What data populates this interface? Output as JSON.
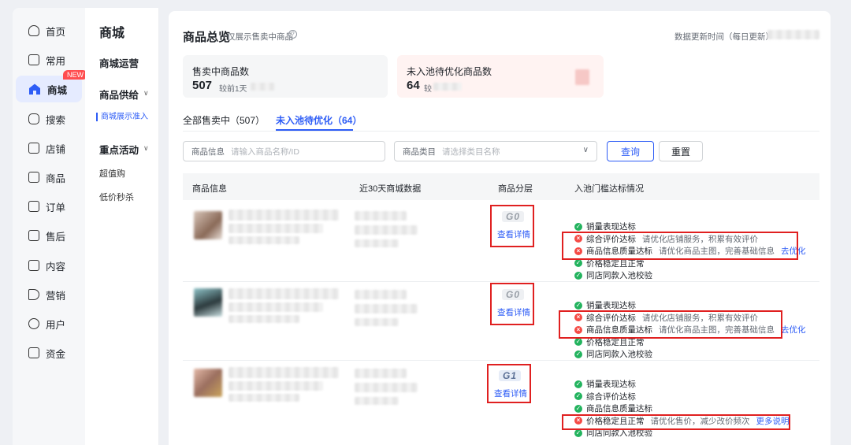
{
  "nav": {
    "items": [
      {
        "label": "首页",
        "icon": "home-outline-icon"
      },
      {
        "label": "常用",
        "icon": "folder-icon"
      },
      {
        "label": "商城",
        "icon": "store-icon",
        "badge": "NEW",
        "active": true
      },
      {
        "label": "搜索",
        "icon": "search-icon"
      },
      {
        "label": "店铺",
        "icon": "shop-icon"
      },
      {
        "label": "商品",
        "icon": "product-icon"
      },
      {
        "label": "订单",
        "icon": "order-icon"
      },
      {
        "label": "售后",
        "icon": "after-sale-icon"
      },
      {
        "label": "内容",
        "icon": "content-icon"
      },
      {
        "label": "营销",
        "icon": "megaphone-icon"
      },
      {
        "label": "用户",
        "icon": "user-icon"
      },
      {
        "label": "资金",
        "icon": "wallet-icon"
      }
    ]
  },
  "subnav": {
    "title": "商城",
    "groups": [
      {
        "label": "商城运营"
      },
      {
        "label": "商品供给",
        "items": [
          "商城展示准入"
        ]
      },
      {
        "label": "重点活动",
        "items": [
          "超值购",
          "低价秒杀"
        ]
      }
    ]
  },
  "header": {
    "title": "商品总览",
    "subtitle": "仅展示售卖中商品",
    "update_label": "数据更新时间（每日更新）"
  },
  "cards": [
    {
      "label": "售卖中商品数",
      "value": "507",
      "compare": "较前1天"
    },
    {
      "label": "未入池待优化商品数",
      "value": "64",
      "compare": "较"
    }
  ],
  "tabs": [
    {
      "label": "全部售卖中（507）"
    },
    {
      "label": "未入池待优化（64）",
      "active": true
    }
  ],
  "filters": {
    "product_label": "商品信息",
    "product_placeholder": "请输入商品名称/ID",
    "category_label": "商品类目",
    "category_placeholder": "请选择类目名称",
    "search_button": "查询",
    "reset_button": "重置"
  },
  "table": {
    "columns": [
      "商品信息",
      "近30天商城数据",
      "商品分层",
      "入池门槛达标情况"
    ],
    "rows": [
      {
        "tier": "G0",
        "detail_link": "查看详情",
        "checks": [
          {
            "status": "ok",
            "text": "销量表现达标"
          },
          {
            "status": "bad",
            "text": "综合评价达标",
            "hint": "请优化店铺服务，积累有效评价"
          },
          {
            "status": "bad",
            "text": "商品信息质量达标",
            "hint": "请优化商品主图，完善基础信息",
            "link": "去优化"
          },
          {
            "status": "ok",
            "text": "价格稳定且正常"
          },
          {
            "status": "ok",
            "text": "同店同款入池校验"
          }
        ]
      },
      {
        "tier": "G0",
        "detail_link": "查看详情",
        "checks": [
          {
            "status": "ok",
            "text": "销量表现达标"
          },
          {
            "status": "bad",
            "text": "综合评价达标",
            "hint": "请优化店铺服务，积累有效评价"
          },
          {
            "status": "bad",
            "text": "商品信息质量达标",
            "hint": "请优化商品主图，完善基础信息",
            "link": "去优化"
          },
          {
            "status": "ok",
            "text": "价格稳定且正常"
          },
          {
            "status": "ok",
            "text": "同店同款入池校验"
          }
        ]
      },
      {
        "tier": "G1",
        "detail_link": "查看详情",
        "checks": [
          {
            "status": "ok",
            "text": "销量表现达标"
          },
          {
            "status": "ok",
            "text": "综合评价达标"
          },
          {
            "status": "ok",
            "text": "商品信息质量达标"
          },
          {
            "status": "bad",
            "text": "价格稳定且正常",
            "hint": "请优化售价，减少改价频次",
            "link": "更多说明"
          },
          {
            "status": "ok",
            "text": "同店同款入池校验"
          }
        ]
      }
    ]
  },
  "colors": {
    "accent": "#2d5cf6",
    "ok": "#23b35e",
    "bad": "#f54a45",
    "highlight": "#e02020"
  }
}
